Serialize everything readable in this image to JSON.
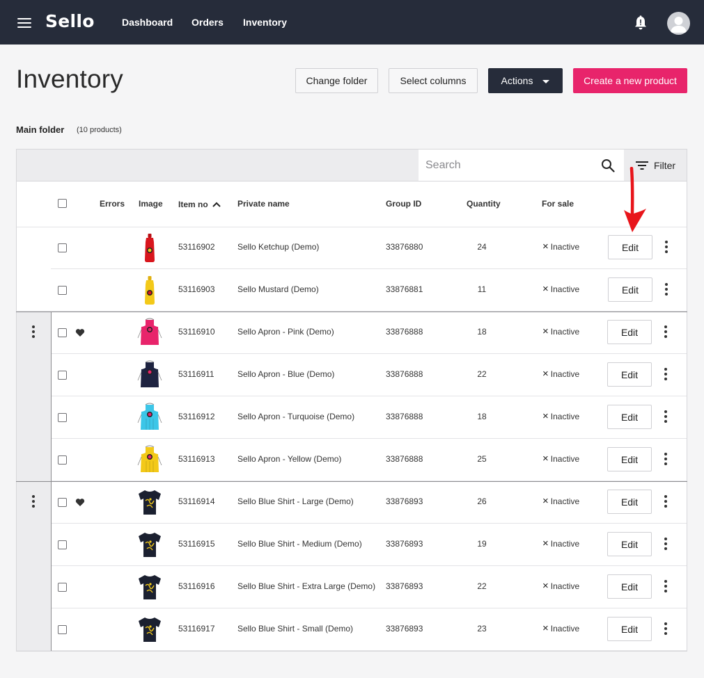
{
  "app": {
    "brand": "Sello"
  },
  "nav": {
    "items": [
      "Dashboard",
      "Orders",
      "Inventory"
    ]
  },
  "header": {
    "title": "Inventory",
    "change_folder": "Change folder",
    "select_columns": "Select columns",
    "actions": "Actions",
    "create": "Create a new product"
  },
  "folder": {
    "name": "Main folder",
    "count": "(10 products)"
  },
  "search": {
    "placeholder": "Search"
  },
  "filter": {
    "label": "Filter"
  },
  "columns": {
    "errors": "Errors",
    "image": "Image",
    "item_no": "Item no",
    "private_name": "Private name",
    "group_id": "Group ID",
    "quantity": "Quantity",
    "for_sale": "For sale"
  },
  "edit_label": "Edit",
  "colors": {
    "topbar": "#262c3a",
    "accent": "#e8246b",
    "arrow": "#e8151b"
  },
  "rows": [
    {
      "item_no": "53116902",
      "name": "Sello Ketchup (Demo)",
      "group_id": "33876880",
      "quantity": "24",
      "status": "Inactive",
      "image": "ketchup-bottle"
    },
    {
      "item_no": "53116903",
      "name": "Sello Mustard (Demo)",
      "group_id": "33876881",
      "quantity": "11",
      "status": "Inactive",
      "image": "mustard-bottle"
    },
    {
      "item_no": "53116910",
      "name": "Sello Apron - Pink (Demo)",
      "group_id": "33876888",
      "quantity": "18",
      "status": "Inactive",
      "image": "apron-pink"
    },
    {
      "item_no": "53116911",
      "name": "Sello Apron - Blue (Demo)",
      "group_id": "33876888",
      "quantity": "22",
      "status": "Inactive",
      "image": "apron-blue"
    },
    {
      "item_no": "53116912",
      "name": "Sello Apron - Turquoise (Demo)",
      "group_id": "33876888",
      "quantity": "18",
      "status": "Inactive",
      "image": "apron-turquoise"
    },
    {
      "item_no": "53116913",
      "name": "Sello Apron - Yellow (Demo)",
      "group_id": "33876888",
      "quantity": "25",
      "status": "Inactive",
      "image": "apron-yellow"
    },
    {
      "item_no": "53116914",
      "name": "Sello Blue Shirt - Large (Demo)",
      "group_id": "33876893",
      "quantity": "26",
      "status": "Inactive",
      "image": "shirt-navy"
    },
    {
      "item_no": "53116915",
      "name": "Sello Blue Shirt - Medium (Demo)",
      "group_id": "33876893",
      "quantity": "19",
      "status": "Inactive",
      "image": "shirt-navy"
    },
    {
      "item_no": "53116916",
      "name": "Sello Blue Shirt - Extra Large (Demo)",
      "group_id": "33876893",
      "quantity": "22",
      "status": "Inactive",
      "image": "shirt-navy"
    },
    {
      "item_no": "53116917",
      "name": "Sello Blue Shirt - Small (Demo)",
      "group_id": "33876893",
      "quantity": "23",
      "status": "Inactive",
      "image": "shirt-navy"
    }
  ]
}
